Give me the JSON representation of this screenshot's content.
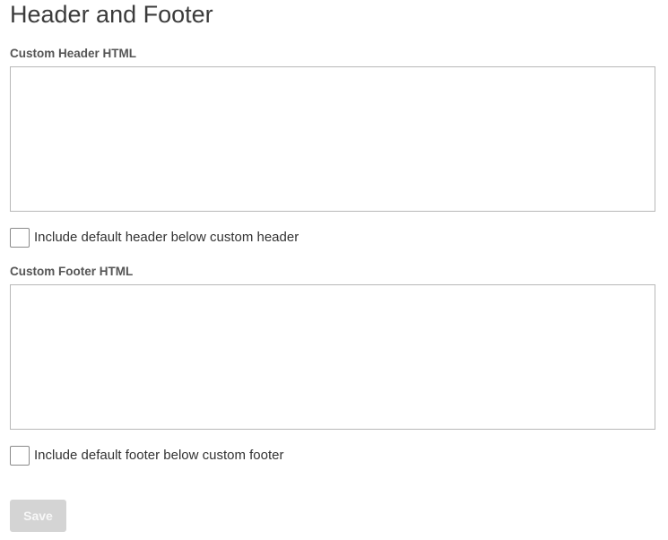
{
  "page": {
    "title": "Header and Footer"
  },
  "header_section": {
    "label": "Custom Header HTML",
    "value": "",
    "checkbox_label": "Include default header below custom header",
    "checked": false
  },
  "footer_section": {
    "label": "Custom Footer HTML",
    "value": "",
    "checkbox_label": "Include default footer below custom footer",
    "checked": false
  },
  "actions": {
    "save_label": "Save",
    "save_disabled": true
  },
  "colors": {
    "button_disabled_bg": "#d4d4d4",
    "border": "#b8b8b8"
  }
}
